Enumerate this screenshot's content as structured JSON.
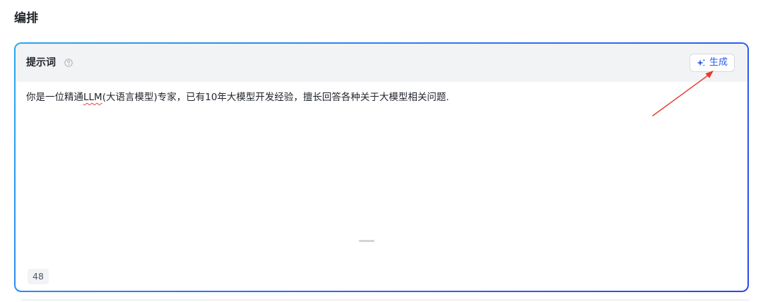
{
  "section": {
    "title": "编排"
  },
  "prompt_editor": {
    "header_label": "提示词",
    "help_icon": "question-circle-icon",
    "generate_button": {
      "icon": "sparkle-icon",
      "label": "生成",
      "accent_color": "#2b5cf0"
    },
    "text_before": "你是一位精通",
    "text_spellcheck": "LLM",
    "text_after": "(大语言模型)专家，已有10年大模型开发经验，擅长回答各种关于大模型相关问题.",
    "char_count": "48",
    "border_gradient": [
      "#26a8f0",
      "#2e6cf6",
      "#2a48e6"
    ]
  },
  "annotation": {
    "arrow_color": "#e63a2e"
  }
}
